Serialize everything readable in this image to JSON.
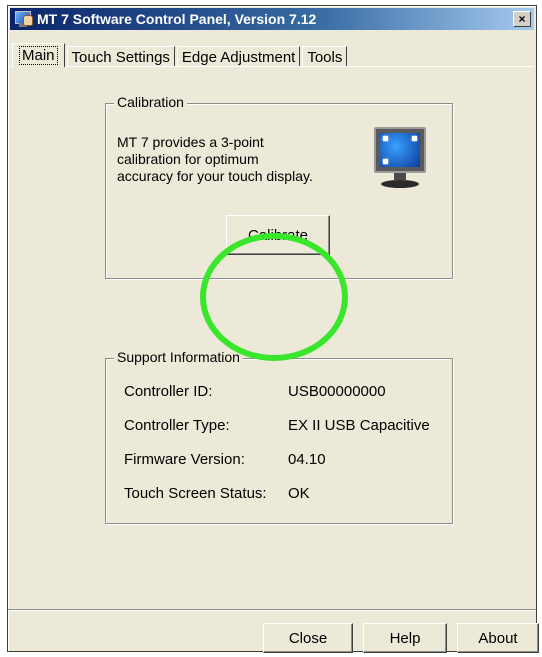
{
  "window": {
    "title": "MT 7 Software Control Panel, Version 7.12",
    "close_glyph": "×"
  },
  "tabs": [
    {
      "label": "Main",
      "active": true
    },
    {
      "label": "Touch Settings",
      "active": false
    },
    {
      "label": "Edge Adjustment",
      "active": false
    },
    {
      "label": "Tools",
      "active": false
    }
  ],
  "calibration": {
    "legend": "Calibration",
    "line1": "MT 7 provides a 3-point",
    "line2": "calibration for optimum",
    "line3": "accuracy for your touch display.",
    "button_label": "Calibrate",
    "icon": "monitor-icon"
  },
  "support": {
    "legend": "Support Information",
    "rows": [
      {
        "label": "Controller ID:",
        "value": "USB00000000"
      },
      {
        "label": "Controller Type:",
        "value": "EX II USB Capacitive"
      },
      {
        "label": "Firmware Version:",
        "value": "04.10"
      },
      {
        "label": "Touch Screen Status:",
        "value": "OK"
      }
    ]
  },
  "footer": {
    "close_label": "Close",
    "help_label": "Help",
    "about_label": "About"
  },
  "colors": {
    "dialog_bg": "#ece9d8",
    "title_bar": "#0a246a",
    "highlight": "#39e62c"
  }
}
